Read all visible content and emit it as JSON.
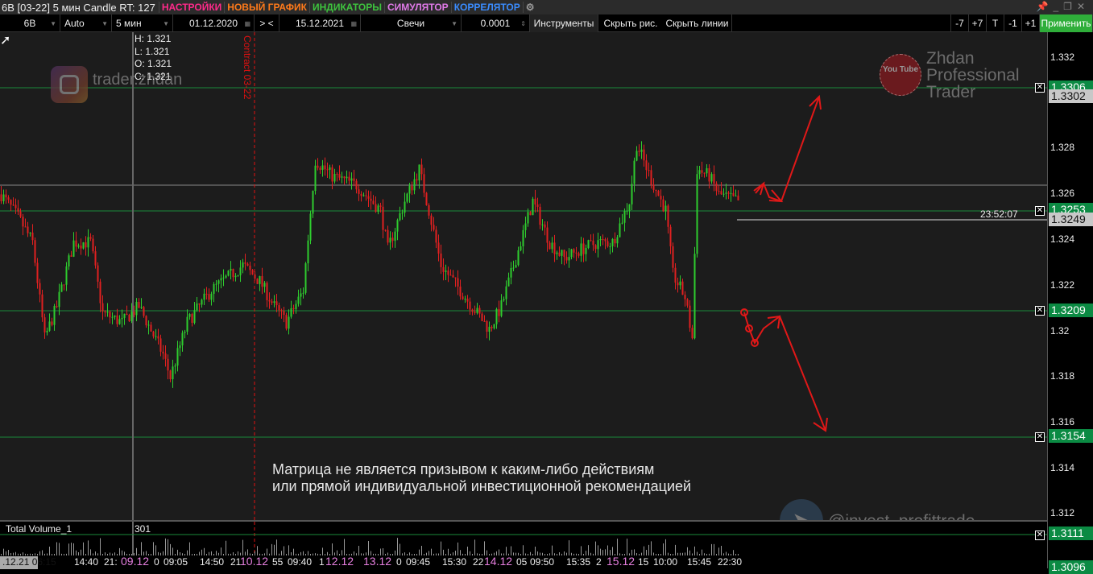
{
  "title": {
    "text": "6B [03-22] 5 мин Candle RT: 127",
    "menu": [
      {
        "label": "НАСТРОЙКИ",
        "color": "#ff2a8a"
      },
      {
        "label": "НОВЫЙ ГРАФИК",
        "color": "#ff7a1a"
      },
      {
        "label": "ИНДИКАТОРЫ",
        "color": "#3ec43e"
      },
      {
        "label": "СИМУЛЯТОР",
        "color": "#e07ae8"
      },
      {
        "label": "КОРРЕЛЯТОР",
        "color": "#3a8cff"
      }
    ]
  },
  "toolbar": {
    "symbol": "6B",
    "scale": "Auto",
    "timeframe": "5 мин",
    "date_from": "01.12.2020",
    "range_btn": "> <",
    "date_to": "15.12.2021",
    "chart_type": "Свечи",
    "tick": "0.0001",
    "tools": "Инструменты",
    "hide_drawings": "Скрыть рис.",
    "hide_lines": "Скрыть линии",
    "btns": [
      "-7",
      "+7",
      "T",
      "-1",
      "+1"
    ],
    "apply": "Применить"
  },
  "ohlc": {
    "h": "H: 1.321",
    "l": "L: 1.321",
    "o": "O: 1.321",
    "c": "C: 1.321"
  },
  "contract_label": "Contract 03-22",
  "watermarks": {
    "instagram": "trader.zhdan",
    "youtube_badge": "You Tube",
    "brand": [
      "Zhdan",
      "Professional",
      "Trader"
    ],
    "telegram": "@invest_profittrade"
  },
  "message": [
    "Матрица не является призывом к каким-либо действиям",
    "или прямой индивидуальной инвестиционной рекомендацией"
  ],
  "timer": "23:52:07",
  "volume": {
    "label": "Total Volume_1",
    "value": "301"
  },
  "price_axis": [
    "1.332",
    "1.328",
    "1.326",
    "1.324",
    "1.322",
    "1.32",
    "1.318",
    "1.316",
    "1.314",
    "1.312"
  ],
  "level_tags": {
    "l1": "1.3306",
    "cur1": "1.3302",
    "l2": "1.3253",
    "cur2": "1.3249",
    "l3": "1.3209",
    "l4": "1.3154",
    "l5": "1.3111",
    "l6": "1.3096"
  },
  "time_axis": {
    "current": ".12.21 06:15",
    "labels": [
      "14:40",
      "21:",
      "09.12",
      "0",
      "09:05",
      "14:50",
      "21",
      "10.12",
      "55",
      "09:40",
      "1",
      "12.12",
      "13.12",
      "0",
      "09:45",
      "15:30",
      "22",
      "14.12",
      "05",
      "09:50",
      "15:35",
      "2",
      "15.12",
      "15",
      "10:00",
      "15:45",
      "22:30"
    ]
  },
  "chart_data": {
    "type": "candlestick",
    "symbol": "6B",
    "price_range": [
      1.311,
      1.3335
    ],
    "price_path": [
      [
        0,
        1.326
      ],
      [
        7,
        1.325
      ],
      [
        13,
        1.3239
      ],
      [
        18,
        1.3197
      ],
      [
        23,
        1.3211
      ],
      [
        30,
        1.3239
      ],
      [
        37,
        1.3239
      ],
      [
        42,
        1.3208
      ],
      [
        50,
        1.3204
      ],
      [
        57,
        1.3211
      ],
      [
        67,
        1.319
      ],
      [
        70,
        1.318
      ],
      [
        77,
        1.3204
      ],
      [
        87,
        1.3218
      ],
      [
        100,
        1.3229
      ],
      [
        107,
        1.3222
      ],
      [
        113,
        1.3211
      ],
      [
        118,
        1.3204
      ],
      [
        125,
        1.3218
      ],
      [
        130,
        1.3275
      ],
      [
        137,
        1.3268
      ],
      [
        147,
        1.3264
      ],
      [
        157,
        1.3253
      ],
      [
        160,
        1.3236
      ],
      [
        167,
        1.3257
      ],
      [
        173,
        1.3271
      ],
      [
        177,
        1.3253
      ],
      [
        182,
        1.3229
      ],
      [
        190,
        1.3218
      ],
      [
        197,
        1.3208
      ],
      [
        202,
        1.3201
      ],
      [
        207,
        1.3211
      ],
      [
        213,
        1.3232
      ],
      [
        220,
        1.3257
      ],
      [
        227,
        1.3239
      ],
      [
        233,
        1.3232
      ],
      [
        240,
        1.3236
      ],
      [
        247,
        1.3239
      ],
      [
        253,
        1.3239
      ],
      [
        260,
        1.3257
      ],
      [
        263,
        1.3282
      ],
      [
        270,
        1.3264
      ],
      [
        275,
        1.3253
      ],
      [
        278,
        1.3225
      ],
      [
        283,
        1.3215
      ],
      [
        286,
        1.3197
      ],
      [
        288,
        1.3271
      ],
      [
        293,
        1.3268
      ],
      [
        297,
        1.326
      ],
      [
        305,
        1.3257
      ]
    ]
  }
}
